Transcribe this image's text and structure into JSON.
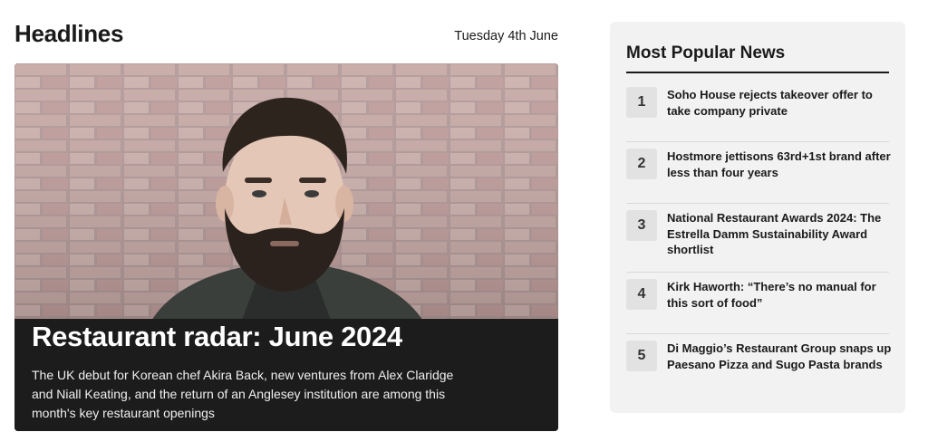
{
  "headlines": {
    "title": "Headlines",
    "date": "Tuesday 4th June",
    "feature": {
      "title": "Restaurant radar: June 2024",
      "summary": "The UK debut for Korean chef Akira Back, new ventures from Alex Claridge and Niall Keating, and the return of an Anglesey institution are among this month's key restaurant openings"
    }
  },
  "popular": {
    "title": "Most Popular News",
    "items": [
      {
        "rank": "1",
        "headline": "Soho House rejects takeover offer to take company private"
      },
      {
        "rank": "2",
        "headline": "Hostmore jettisons 63rd+1st brand after less than four years"
      },
      {
        "rank": "3",
        "headline": "National Restaurant Awards 2024: The Estrella Damm Sustainability Award shortlist"
      },
      {
        "rank": "4",
        "headline": "Kirk Haworth: “There’s no manual for this sort of food”"
      },
      {
        "rank": "5",
        "headline": "Di Maggio’s Restaurant Group snaps up Paesano Pizza and Sugo Pasta brands"
      }
    ]
  },
  "colors": {
    "caption_bg": "#1c1c1c",
    "panel_bg": "#f2f2f2",
    "rank_bg": "#e2e2e2",
    "text": "#1a1a1a"
  }
}
